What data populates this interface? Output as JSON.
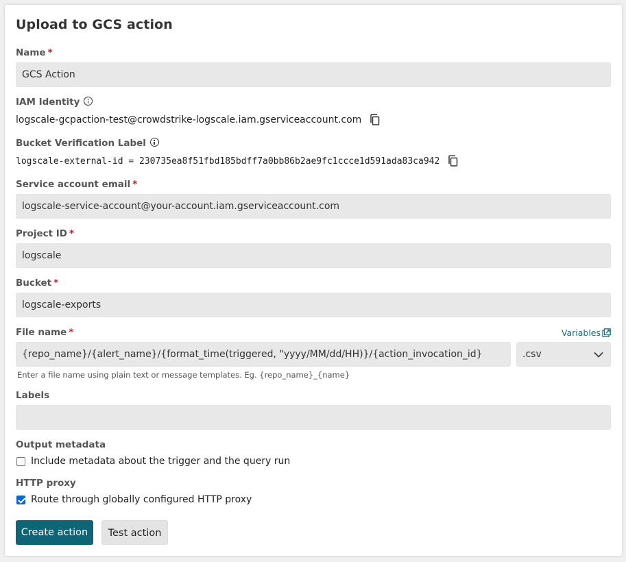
{
  "title": "Upload to GCS action",
  "required_marker": "*",
  "name": {
    "label": "Name",
    "value": "GCS Action"
  },
  "iam_identity": {
    "label": "IAM Identity",
    "value": "logscale-gcpaction-test@crowdstrike-logscale.iam.gserviceaccount.com"
  },
  "bucket_verification": {
    "label": "Bucket Verification Label",
    "value": "logscale-external-id = 230735ea8f51fbd185bdff7a0bb86b2ae9fc1ccce1d591ada83ca942"
  },
  "service_account": {
    "label": "Service account email",
    "value": "logscale-service-account@your-account.iam.gserviceaccount.com"
  },
  "project_id": {
    "label": "Project ID",
    "value": "logscale"
  },
  "bucket": {
    "label": "Bucket",
    "value": "logscale-exports"
  },
  "file_name": {
    "label": "File name",
    "variables_link": "Variables",
    "value": "{repo_name}/{alert_name}/{format_time(triggered, \"yyyy/MM/dd/HH)}/{action_invocation_id}",
    "extension": ".csv",
    "hint": "Enter a file name using plain text or message templates. Eg. {repo_name}_{name}"
  },
  "labels": {
    "label": "Labels",
    "value": ""
  },
  "output_metadata": {
    "label": "Output metadata",
    "checkbox_label": "Include metadata about the trigger and the query run",
    "checked": false
  },
  "http_proxy": {
    "label": "HTTP proxy",
    "checkbox_label": "Route through globally configured HTTP proxy",
    "checked": true
  },
  "buttons": {
    "create": "Create action",
    "test": "Test action"
  },
  "colors": {
    "primary": "#0d6575",
    "required": "#b8242c",
    "link": "#1b6e78",
    "checkbox": "#0b63d6"
  }
}
